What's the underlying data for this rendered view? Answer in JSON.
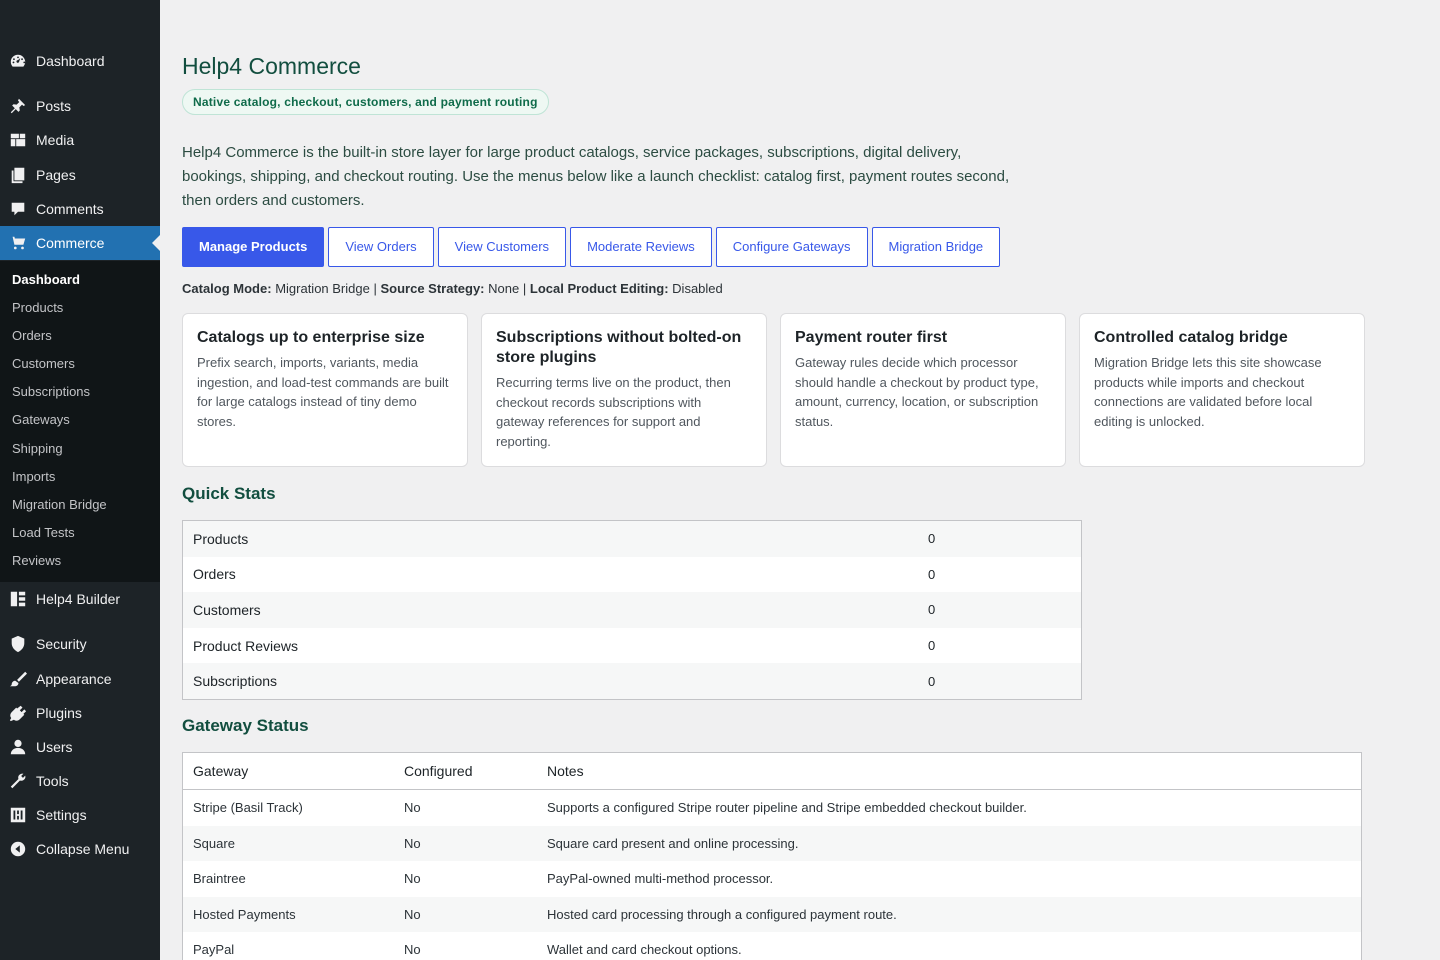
{
  "sidebar": {
    "items": [
      {
        "label": "Dashboard",
        "icon": "dashboard-icon"
      },
      {
        "label": "Posts",
        "icon": "pin-icon"
      },
      {
        "label": "Media",
        "icon": "media-icon"
      },
      {
        "label": "Pages",
        "icon": "pages-icon"
      },
      {
        "label": "Comments",
        "icon": "comment-icon"
      },
      {
        "label": "Commerce",
        "icon": "cart-icon"
      },
      {
        "label": "Help4 Builder",
        "icon": "grid-icon"
      },
      {
        "label": "Security",
        "icon": "shield-icon"
      },
      {
        "label": "Appearance",
        "icon": "brush-icon"
      },
      {
        "label": "Plugins",
        "icon": "plug-icon"
      },
      {
        "label": "Users",
        "icon": "user-icon"
      },
      {
        "label": "Tools",
        "icon": "wrench-icon"
      },
      {
        "label": "Settings",
        "icon": "settings-icon"
      },
      {
        "label": "Collapse Menu",
        "icon": "collapse-icon"
      }
    ],
    "submenu": [
      "Dashboard",
      "Products",
      "Orders",
      "Customers",
      "Subscriptions",
      "Gateways",
      "Shipping",
      "Imports",
      "Migration Bridge",
      "Load Tests",
      "Reviews"
    ]
  },
  "main": {
    "title": "Help4 Commerce",
    "tagline": "Native catalog, checkout, customers, and payment routing",
    "intro": "Help4 Commerce is the built-in store layer for large product catalogs, service packages, subscriptions, digital delivery, bookings, shipping, and checkout routing. Use the menus below like a launch checklist: catalog first, payment routes second, then orders and customers.",
    "actions": [
      "Manage Products",
      "View Orders",
      "View Customers",
      "Moderate Reviews",
      "Configure Gateways",
      "Migration Bridge"
    ],
    "status": {
      "catalog_mode_label": "Catalog Mode:",
      "catalog_mode": "Migration Bridge",
      "source_strategy_label": "Source Strategy:",
      "source_strategy": "None",
      "local_editing_label": "Local Product Editing:",
      "local_editing": "Disabled",
      "sep": "|"
    },
    "cards": [
      {
        "title": "Catalogs up to enterprise size",
        "body": "Prefix search, imports, variants, media ingestion, and load-test commands are built for large catalogs instead of tiny demo stores."
      },
      {
        "title": "Subscriptions without bolted-on store plugins",
        "body": "Recurring terms live on the product, then checkout records subscriptions with gateway references for support and reporting."
      },
      {
        "title": "Payment router first",
        "body": "Gateway rules decide which processor should handle a checkout by product type, amount, currency, location, or subscription status."
      },
      {
        "title": "Controlled catalog bridge",
        "body": "Migration Bridge lets this site showcase products while imports and checkout connections are validated before local editing is unlocked."
      }
    ],
    "quick_stats_title": "Quick Stats",
    "quick_stats": [
      {
        "label": "Products",
        "value": "0"
      },
      {
        "label": "Orders",
        "value": "0"
      },
      {
        "label": "Customers",
        "value": "0"
      },
      {
        "label": "Product Reviews",
        "value": "0"
      },
      {
        "label": "Subscriptions",
        "value": "0"
      }
    ],
    "gateway_title": "Gateway Status",
    "gateway_headers": [
      "Gateway",
      "Configured",
      "Notes"
    ],
    "gateways": [
      {
        "name": "Stripe (Basil Track)",
        "configured": "No",
        "notes": "Supports a configured Stripe router pipeline and Stripe embedded checkout builder."
      },
      {
        "name": "Square",
        "configured": "No",
        "notes": "Square card present and online processing."
      },
      {
        "name": "Braintree",
        "configured": "No",
        "notes": "PayPal-owned multi-method processor."
      },
      {
        "name": "Hosted Payments",
        "configured": "No",
        "notes": "Hosted card processing through a configured payment route."
      },
      {
        "name": "PayPal",
        "configured": "No",
        "notes": "Wallet and card checkout options."
      }
    ]
  },
  "colors": {
    "sidebar_bg": "#1d2327",
    "active_menu": "#2271b1",
    "primary_button": "#3858e9",
    "heading_green": "#124e3f"
  }
}
